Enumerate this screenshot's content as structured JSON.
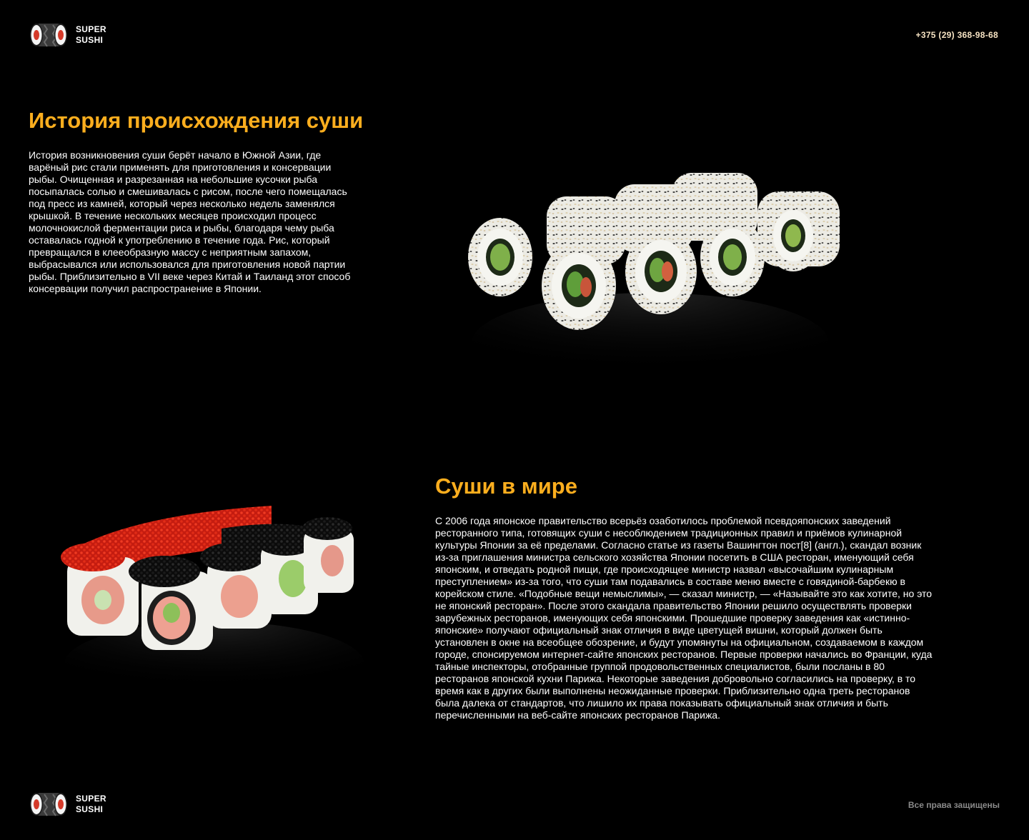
{
  "brand": {
    "line1": "SUPER",
    "line2": "SUSHI"
  },
  "header": {
    "phone": "+375 (29) 368-98-68"
  },
  "section1": {
    "title": "История происхождения суши",
    "text": "История возникновения суши берёт начало в Южной Азии, где варёный рис стали применять для приготовления и консервации рыбы. Очищенная и разрезанная на небольшие кусочки рыба посыпалась солью и смешивалась с рисом, после чего помещалась под пресс из камней, который через несколько недель заменялся крышкой. В течение нескольких месяцев происходил процесс молочнокислой ферментации риса и рыбы, благодаря чему рыба оставалась годной к употреблению в течение года. Рис, который превращался в клееобразную массу с неприятным запахом, выбрасывался или использовался для приготовления новой партии рыбы. Приблизительно в VII веке через Китай и Таиланд этот способ консервации получил распространение в Японии."
  },
  "section2": {
    "title": "Суши в мире",
    "text": "С 2006 года японское правительство всерьёз озаботилось проблемой псевдояпонских заведений ресторанного типа, готовящих суши с несоблюдением традиционных правил и приёмов кулинарной культуры Японии за её пределами. Согласно статье из газеты Вашингтон пост[8] (англ.), скандал возник из-за приглашения министра сельского хозяйства Японии посетить в США ресторан, именующий себя японским, и отведать родной пищи, где происходящее министр назвал «высочайшим кулинарным преступлением» из-за того, что суши там подавались в составе меню вместе с говядиной-барбекю в корейском стиле. «Подобные вещи немыслимы», — сказал министр, — «Называйте это как хотите, но это не японский ресторан». После этого скандала правительство Японии решило осуществлять проверки зарубежных ресторанов, именующих себя японскими. Прошедшие проверку заведения как «истинно-японские» получают официальный знак отличия в виде цветущей вишни, который должен быть установлен в окне на всеобщее обозрение, и будут упомянуты на официальном, создаваемом в каждом городе, спонсируемом интернет-сайте японских ресторанов. Первые проверки начались во Франции, куда тайные инспекторы, отобранные группой продовольственных специалистов, были посланы в 80 ресторанов японской кухни Парижа. Некоторые заведения добровольно согласились на проверку, в то время как в других были выполнены неожиданные проверки. Приблизительно одна треть ресторанов была далека от стандартов, что лишило их права показывать официальный знак отличия и быть перечисленными на веб-сайте японских ресторанов Парижа."
  },
  "footer": {
    "rights": "Все права защищены"
  },
  "colors": {
    "accent": "#fcae1e",
    "phone": "#f6e3c3",
    "muted": "#8a8a8a",
    "background": "#000000"
  }
}
